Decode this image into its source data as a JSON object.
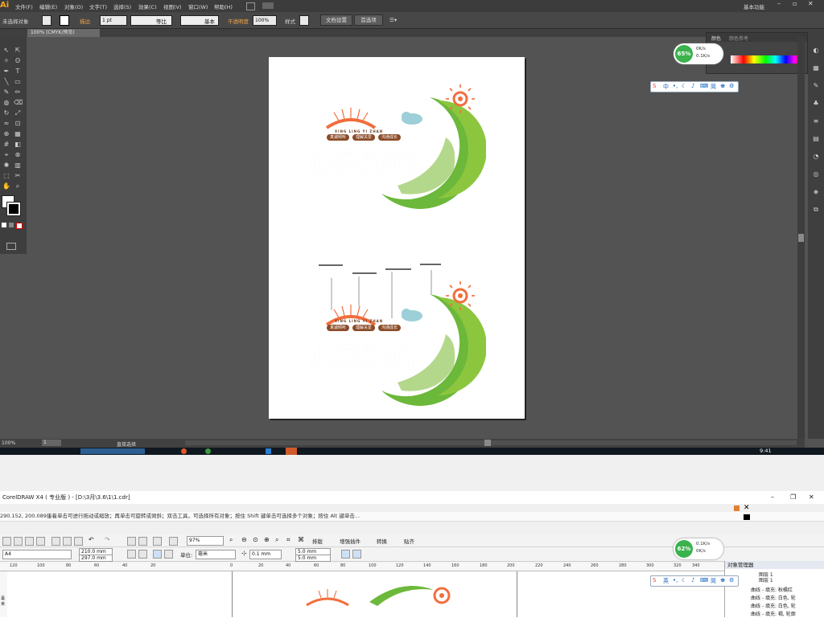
{
  "illustrator": {
    "app_logo": "Ai",
    "menu": [
      "文件(F)",
      "编辑(E)",
      "对象(O)",
      "文字(T)",
      "选择(S)",
      "效果(C)",
      "视图(V)",
      "窗口(W)",
      "帮助(H)"
    ],
    "workspace": "基本功能",
    "control": {
      "selection": "未选择对象",
      "stroke_label": "描边",
      "stroke_weight": "1 pt",
      "stroke_profile": "等比",
      "brush": "基本",
      "opacity_label": "不透明度",
      "opacity_value": "100%",
      "style_label": "样式",
      "doc_setup": "文档设置",
      "preferences": "首选项"
    },
    "doc_tab": "100% (CMYK/预览)",
    "color_panel": {
      "tab_color": "颜色",
      "tab_guide": "颜色参考"
    },
    "status": {
      "zoom": "100%",
      "page": "1",
      "tool": "直接选择"
    },
    "time": "9:41"
  },
  "artwork": {
    "title": "心灵驿站",
    "pinyin": "XING LING YI ZHAN",
    "tags": [
      "真诚倾听",
      "理解关爱",
      "沟通成长"
    ]
  },
  "widgets": {
    "net1": {
      "percent": "65%",
      "up": "0K/s",
      "down": "0.1K/s"
    },
    "net2": {
      "percent": "62%",
      "up": "0.1K/s",
      "down": "0K/s"
    },
    "ime1": [
      "中",
      "简"
    ],
    "ime2": [
      "英",
      "简"
    ]
  },
  "coreldraw": {
    "title": "CorelDRAW X4 ( 专业版 ) - [D:\\3月\\3.6\\1\\1.cdr]",
    "coords": "290.152, 200.089 )",
    "hint": "接着单击可进行拖动或缩放；再单击可旋转或倾斜；双击工具，可选择所有对象；按住 Shift 键单击可选择多个对象；按住 Alt 键单击...",
    "zoom": "97%",
    "menu_items": [
      "排版",
      "增强插件",
      "转换",
      "贴齐"
    ],
    "page_size": "A4",
    "width": "210.0 mm",
    "height": "297.0 mm",
    "units_label": "单位:",
    "units": "毫米",
    "nudge": "0.1 mm",
    "dup_x": "5.0 mm",
    "dup_y": "5.0 mm",
    "ruler_ticks": [
      "120",
      "100",
      "80",
      "60",
      "40",
      "20",
      "0",
      "20",
      "40",
      "60",
      "80",
      "100",
      "120",
      "140",
      "160",
      "180",
      "200",
      "220",
      "240",
      "260",
      "280",
      "300",
      "320",
      "340"
    ],
    "ruler_unit": "毫米",
    "object_manager": {
      "title": "对象管理器",
      "layers": [
        "图层 1",
        "图层 1"
      ],
      "rows": [
        "曲线 - 填充: 秋橘红",
        "曲线 - 填充: 白色, 轮",
        "曲线 - 填充: 白色, 轮",
        "曲线 - 填充: 褐, 轮廓"
      ]
    }
  }
}
